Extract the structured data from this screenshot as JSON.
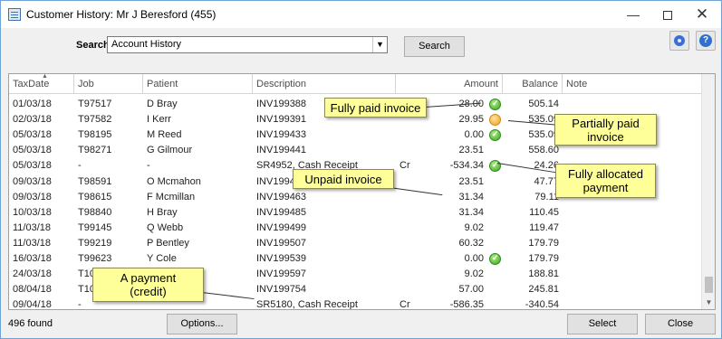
{
  "window": {
    "title": "Customer History: Mr J Beresford (455)",
    "minimize": "—",
    "close": "✕"
  },
  "search": {
    "label": "Search",
    "selected": "Account History",
    "button": "Search"
  },
  "columns": [
    "TaxDate",
    "Job",
    "Patient",
    "Description",
    "Amount",
    "Balance",
    "Note"
  ],
  "rows": [
    {
      "date": "01/03/18",
      "job": "T97517",
      "patient": "D Bray",
      "desc": "INV199388",
      "cr": "",
      "amount": "28.00",
      "status": "paid",
      "balance": "505.14"
    },
    {
      "date": "02/03/18",
      "job": "T97582",
      "patient": "I Kerr",
      "desc": "INV199391",
      "cr": "",
      "amount": "29.95",
      "status": "partial",
      "balance": "535.09"
    },
    {
      "date": "05/03/18",
      "job": "T98195",
      "patient": "M Reed",
      "desc": "INV199433",
      "cr": "",
      "amount": "0.00",
      "status": "paid",
      "balance": "535.09"
    },
    {
      "date": "05/03/18",
      "job": "T98271",
      "patient": "G Gilmour",
      "desc": "INV199441",
      "cr": "",
      "amount": "23.51",
      "status": "",
      "balance": "558.60"
    },
    {
      "date": "05/03/18",
      "job": "-",
      "patient": "-",
      "desc": "SR4952, Cash Receipt",
      "cr": "Cr",
      "amount": "-534.34",
      "status": "paid",
      "balance": "24.26"
    },
    {
      "date": "09/03/18",
      "job": "T98591",
      "patient": "O Mcmahon",
      "desc": "INV199462",
      "cr": "",
      "amount": "23.51",
      "status": "",
      "balance": "47.77"
    },
    {
      "date": "09/03/18",
      "job": "T98615",
      "patient": "F Mcmillan",
      "desc": "INV199463",
      "cr": "",
      "amount": "31.34",
      "status": "",
      "balance": "79.11"
    },
    {
      "date": "10/03/18",
      "job": "T98840",
      "patient": "H Bray",
      "desc": "INV199485",
      "cr": "",
      "amount": "31.34",
      "status": "",
      "balance": "110.45"
    },
    {
      "date": "11/03/18",
      "job": "T99145",
      "patient": "Q Webb",
      "desc": "INV199499",
      "cr": "",
      "amount": "9.02",
      "status": "",
      "balance": "119.47"
    },
    {
      "date": "11/03/18",
      "job": "T99219",
      "patient": "P Bentley",
      "desc": "INV199507",
      "cr": "",
      "amount": "60.32",
      "status": "",
      "balance": "179.79"
    },
    {
      "date": "16/03/18",
      "job": "T99623",
      "patient": "Y Cole",
      "desc": "INV199539",
      "cr": "",
      "amount": "0.00",
      "status": "paid",
      "balance": "179.79"
    },
    {
      "date": "24/03/18",
      "job": "T10",
      "patient": "",
      "desc": "INV199597",
      "cr": "",
      "amount": "9.02",
      "status": "",
      "balance": "188.81"
    },
    {
      "date": "08/04/18",
      "job": "T10",
      "patient": "",
      "desc": "INV199754",
      "cr": "",
      "amount": "57.00",
      "status": "",
      "balance": "245.81"
    },
    {
      "date": "09/04/18",
      "job": "-",
      "patient": "",
      "desc": "SR5180, Cash Receipt",
      "cr": "Cr",
      "amount": "-586.35",
      "status": "",
      "balance": "-340.54"
    }
  ],
  "callouts": {
    "fully_paid": "Fully paid invoice",
    "partially_paid": "Partially paid invoice",
    "unpaid": "Unpaid invoice",
    "fully_allocated": "Fully allocated payment",
    "payment_credit": "A payment (credit)"
  },
  "footer": {
    "found": "496 found",
    "options": "Options...",
    "select": "Select",
    "close": "Close"
  },
  "colors": {
    "accent": "#2f6fd0",
    "callout": "#ffff99",
    "paid": "#36a22a",
    "partial": "#f0a020"
  }
}
